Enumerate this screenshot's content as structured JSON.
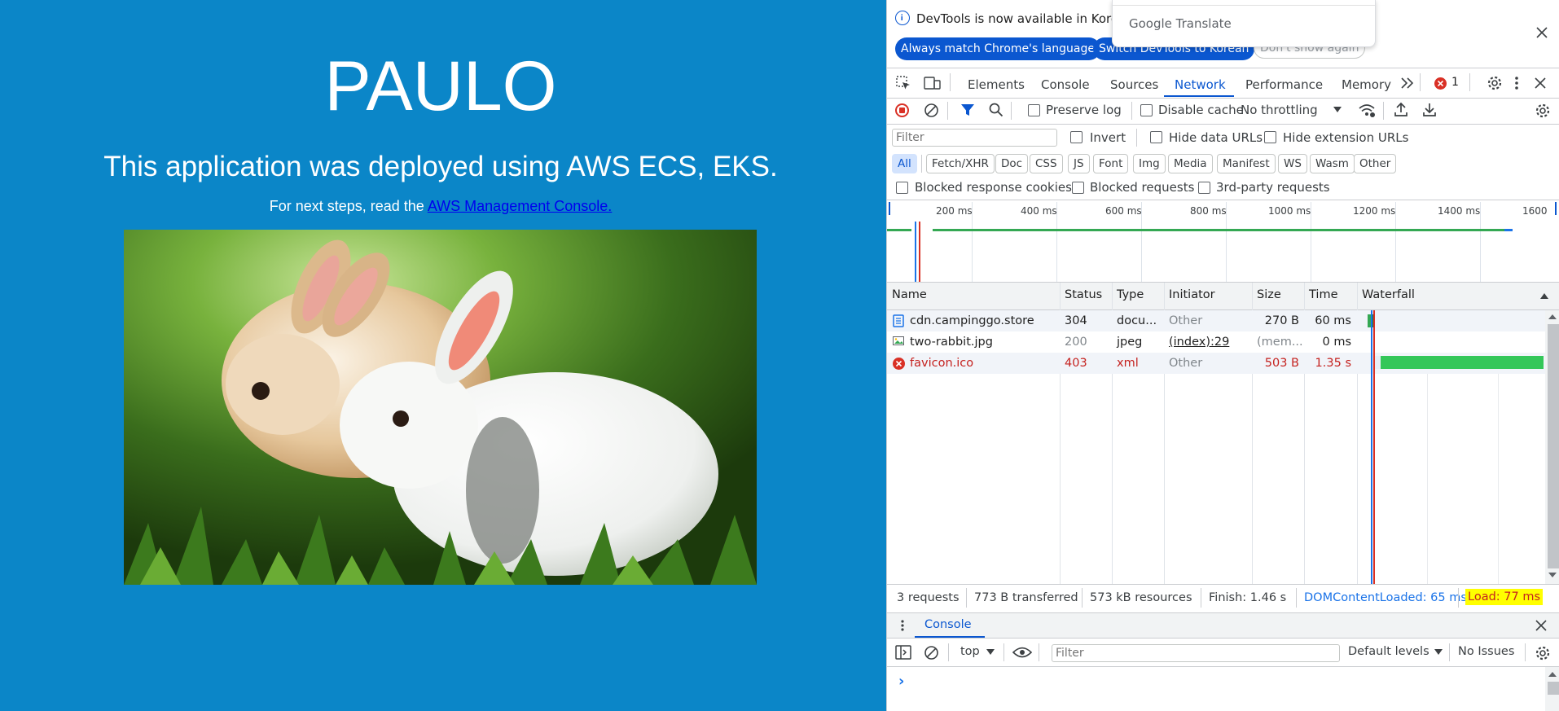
{
  "page": {
    "title": "PAULO",
    "subtitle": "This application was deployed using AWS ECS, EKS.",
    "next_steps_prefix": "For next steps, read the",
    "next_steps_link": "AWS Management Console."
  },
  "devtools": {
    "banner": {
      "message": "DevTools is now available in Korean!",
      "match_language_button": "Always match Chrome's language",
      "switch_button": "Switch DevTools to Korean",
      "dont_show_button": "Don't show again",
      "translate_popup": "Google Translate"
    },
    "tabs": [
      "Elements",
      "Console",
      "Sources",
      "Network",
      "Performance",
      "Memory"
    ],
    "active_tab": "Network",
    "error_count": "1",
    "toolbar": {
      "preserve_log": "Preserve log",
      "disable_cache": "Disable cache",
      "throttling": "No throttling"
    },
    "filter_bar": {
      "placeholder": "Filter",
      "invert": "Invert",
      "hide_data_urls": "Hide data URLs",
      "hide_extension_urls": "Hide extension URLs"
    },
    "type_filters": [
      "All",
      "Fetch/XHR",
      "Doc",
      "CSS",
      "JS",
      "Font",
      "Img",
      "Media",
      "Manifest",
      "WS",
      "Wasm",
      "Other"
    ],
    "active_type_filter": "All",
    "more_filters": {
      "blocked_cookies": "Blocked response cookies",
      "blocked_requests": "Blocked requests",
      "third_party": "3rd-party requests"
    },
    "overview_ticks": [
      "200 ms",
      "400 ms",
      "600 ms",
      "800 ms",
      "1000 ms",
      "1200 ms",
      "1400 ms",
      "1600"
    ],
    "table": {
      "columns": [
        "Name",
        "Status",
        "Type",
        "Initiator",
        "Size",
        "Time",
        "Waterfall"
      ],
      "rows": [
        {
          "name": "cdn.campinggo.store",
          "status": "304",
          "type": "docu...",
          "initiator": "Other",
          "size": "270 B",
          "time": "60 ms"
        },
        {
          "name": "two-rabbit.jpg",
          "status": "200",
          "type": "jpeg",
          "initiator": "(index):29",
          "size": "(mem...",
          "time": "0 ms"
        },
        {
          "name": "favicon.ico",
          "status": "403",
          "type": "xml",
          "initiator": "Other",
          "size": "503 B",
          "time": "1.35 s"
        }
      ]
    },
    "summary": {
      "requests": "3 requests",
      "transferred": "773 B transferred",
      "resources": "573 kB resources",
      "finish": "Finish: 1.46 s",
      "dom_content_loaded": "DOMContentLoaded: 65 ms",
      "load": "Load: 77 ms"
    },
    "drawer": {
      "tab": "Console",
      "context": "top",
      "filter_placeholder": "Filter",
      "levels": "Default levels",
      "issues": "No Issues",
      "prompt": "›"
    },
    "colors": {
      "accent": "#0b57d0",
      "error": "#c5221f",
      "waterfall_green": "#34a853",
      "load_highlight": "#ffff00"
    }
  }
}
